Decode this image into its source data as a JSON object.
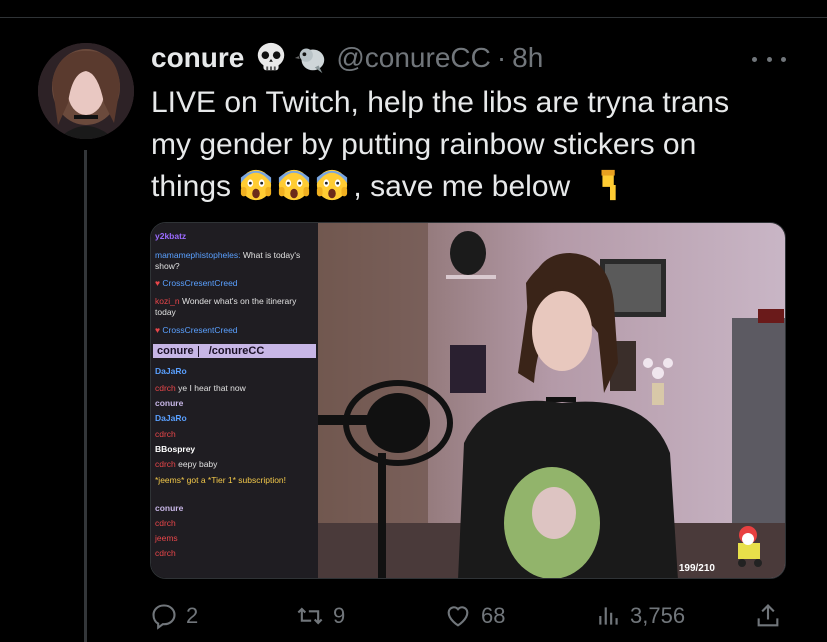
{
  "tweet": {
    "display_name": "conure",
    "handle": "@conureCC",
    "separator": "·",
    "time": "8h",
    "text_line1": "LIVE on Twitch, help the libs are tryna trans",
    "text_line2": "my gender by putting rainbow stickers on",
    "text_line3_a": "things",
    "text_line3_b": ", save me below"
  },
  "media": {
    "chat": [
      {
        "user": "y2kbatz",
        "msg": "",
        "color": "#9b6bff"
      },
      {
        "user": "mamamephistopheles:",
        "msg": "What is today's show?",
        "color": "#5aa0ff"
      },
      {
        "user": "CrossCresentCreed",
        "msg": "",
        "color": "#5aa0ff"
      },
      {
        "user": "kozi_n",
        "msg": "Wonder what's on the itinerary today",
        "color": "#e8464a"
      },
      {
        "user": "CrossCresentCreed",
        "msg": "",
        "color": "#5aa0ff"
      },
      {
        "user": "DaJaRo",
        "msg": "",
        "color": "#5aa0ff"
      },
      {
        "user": "cdrch",
        "msg": "ye I hear that now",
        "color": "#e8464a"
      },
      {
        "user": "conure",
        "msg": "",
        "color": "#c7b6e6"
      },
      {
        "user": "DaJaRo",
        "msg": "",
        "color": "#5aa0ff"
      },
      {
        "user": "cdrch",
        "msg": "",
        "color": "#e8464a"
      },
      {
        "user": "BBosprey",
        "msg": "",
        "color": "#ffffff"
      },
      {
        "user": "cdrch",
        "msg": "eepy baby",
        "color": "#e8464a"
      },
      {
        "user": "*jeems* got a *Tier 1* subscription!",
        "msg": "",
        "color": "#f3c94a"
      },
      {
        "user": "conure",
        "msg": "",
        "color": "#c7b6e6"
      },
      {
        "user": "cdrch",
        "msg": "",
        "color": "#e8464a"
      },
      {
        "user": "jeems",
        "msg": "",
        "color": "#e8464a"
      },
      {
        "user": "cdrch",
        "msg": "",
        "color": "#e8464a"
      }
    ],
    "banner_name": "conure",
    "banner_link": "/conureCC",
    "counter": "199/210"
  },
  "actions": {
    "replies": "2",
    "retweets": "9",
    "likes": "68",
    "views": "3,756"
  },
  "colors": {
    "muted": "#71767b",
    "text": "#e7e9ea",
    "background": "#000000"
  }
}
